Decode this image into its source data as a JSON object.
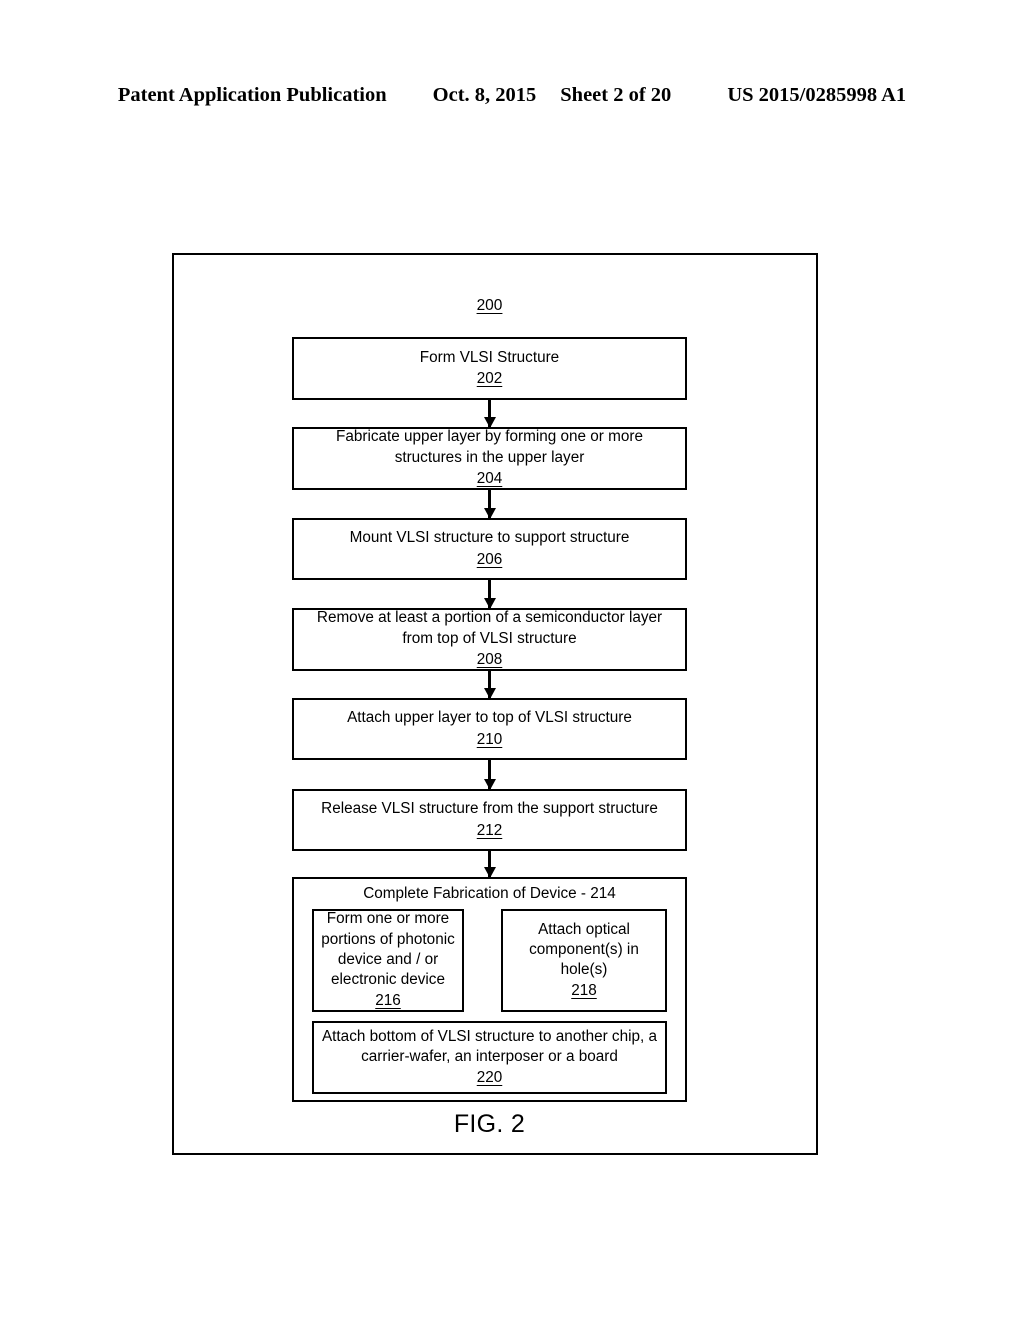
{
  "header": {
    "publication": "Patent Application Publication",
    "date": "Oct. 8, 2015",
    "sheet": "Sheet 2 of 20",
    "patent_number": "US 2015/0285998 A1"
  },
  "figure": {
    "caption": "FIG. 2",
    "diagram_ref": "200",
    "steps": [
      {
        "id": "202",
        "label": "Form VLSI Structure",
        "num": "202"
      },
      {
        "id": "204",
        "label": "Fabricate upper layer by forming one or more structures in the upper layer",
        "num": "204"
      },
      {
        "id": "206",
        "label": "Mount VLSI structure to support structure",
        "num": "206"
      },
      {
        "id": "208",
        "label": "Remove at least a portion of a semiconductor layer from top of VLSI structure",
        "num": "208"
      },
      {
        "id": "210",
        "label": "Attach upper layer to top of VLSI structure",
        "num": "210"
      },
      {
        "id": "212",
        "label": "Release VLSI structure from the support structure",
        "num": "212"
      }
    ],
    "group": {
      "title": "Complete Fabrication of Device - 214",
      "num": "214",
      "sub_steps": [
        {
          "id": "216",
          "label": "Form one or more portions of photonic device and / or electronic device",
          "num": "216"
        },
        {
          "id": "218",
          "label": "Attach optical component(s) in hole(s)",
          "num": "218"
        },
        {
          "id": "220",
          "label": "Attach bottom of VLSI structure to another chip, a carrier-wafer, an interposer or a board",
          "num": "220"
        }
      ]
    }
  },
  "colors": {
    "ink": "#000000",
    "paper": "#ffffff"
  }
}
